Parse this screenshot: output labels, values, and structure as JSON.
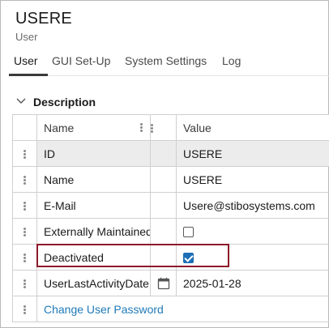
{
  "header": {
    "title": "USERE",
    "subtitle": "User"
  },
  "tabs": [
    {
      "label": "User",
      "active": true
    },
    {
      "label": "GUI Set-Up",
      "active": false
    },
    {
      "label": "System Settings",
      "active": false
    },
    {
      "label": "Log",
      "active": false
    }
  ],
  "section": {
    "label": "Description",
    "icon": "chevron-down-icon"
  },
  "grid": {
    "columns": {
      "name": "Name",
      "value": "Value"
    },
    "rows": [
      {
        "name": "ID",
        "value": "USERE",
        "readonly": true
      },
      {
        "name": "Name",
        "value": "USERE",
        "readonly": false
      },
      {
        "name": "E-Mail",
        "value": "Usere@stibosystems.com",
        "readonly": false
      },
      {
        "name": "Externally Maintained",
        "checked": false,
        "readonly": false
      },
      {
        "name": "Deactivated",
        "checked": true,
        "readonly": false,
        "highlighted": true
      },
      {
        "name": "UserLastActivityDate",
        "value": "2025-01-28",
        "icon": "calendar-icon",
        "readonly": false
      }
    ],
    "link": "Change User Password"
  },
  "colors": {
    "accent": "#1d6fb8",
    "link": "#1f7ab8",
    "highlight_border": "#8b1a2a",
    "readonly_bg": "#ececec"
  }
}
